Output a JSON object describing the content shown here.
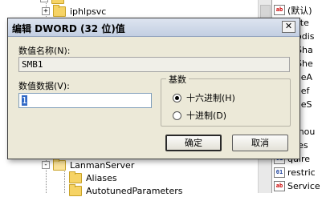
{
  "tree": {
    "nodes": [
      {
        "label": "iphlpsvc",
        "expander": "+"
      },
      {
        "label": "LanmanServer",
        "expander": "-"
      },
      {
        "label": "Aliases"
      },
      {
        "label": "AutotunedParameters"
      }
    ]
  },
  "values_pane": {
    "rows": [
      {
        "icon": "ab",
        "name": "(默认)"
      },
      {
        "icon": "bin",
        "name": "juste"
      },
      {
        "icon": "bin",
        "name": "otodis"
      },
      {
        "icon": "bin",
        "name": "toSha"
      },
      {
        "icon": "bin",
        "name": "toShe"
      },
      {
        "icon": "bin",
        "name": "ableA"
      },
      {
        "icon": "bin",
        "name": "ablef"
      },
      {
        "icon": "bin",
        "name": "ableS"
      },
      {
        "icon": "bin",
        "name": "id"
      },
      {
        "icon": "bin",
        "name": "annou"
      },
      {
        "icon": "bin",
        "name": "llSes"
      },
      {
        "icon": "bin",
        "name": "quire"
      },
      {
        "icon": "bin",
        "name": "restric"
      },
      {
        "icon": "ab",
        "name": "Service"
      }
    ]
  },
  "dialog": {
    "title": "编辑 DWORD (32 位)值",
    "close_glyph": "✕",
    "value_name_label": "数值名称(N):",
    "value_name": "SMB1",
    "value_data_label": "数值数据(V):",
    "value_data": "1",
    "base": {
      "legend": "基数",
      "options": [
        {
          "label": "十六进制(H)",
          "checked": true
        },
        {
          "label": "十进制(D)",
          "checked": false
        }
      ]
    },
    "ok_label": "确定",
    "cancel_label": "取消"
  }
}
